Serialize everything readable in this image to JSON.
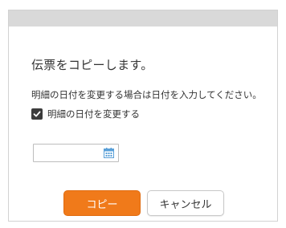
{
  "dialog": {
    "message": "伝票をコピーします。",
    "note": "明細の日付を変更する場合は日付を入力してください。",
    "checkbox": {
      "label": "明細の日付を変更する",
      "checked": true
    },
    "date_input": {
      "value": "",
      "placeholder": ""
    },
    "buttons": {
      "copy_label": "コピー",
      "cancel_label": "キャンセル"
    }
  },
  "colors": {
    "accent": "#f07a1a",
    "titlebar": "#d9d9d9",
    "checkbox": "#3c3c3c",
    "calendar_icon": "#5aa0d8"
  },
  "icons": {
    "checkbox_check": "check-icon",
    "date_picker": "calendar-icon"
  }
}
